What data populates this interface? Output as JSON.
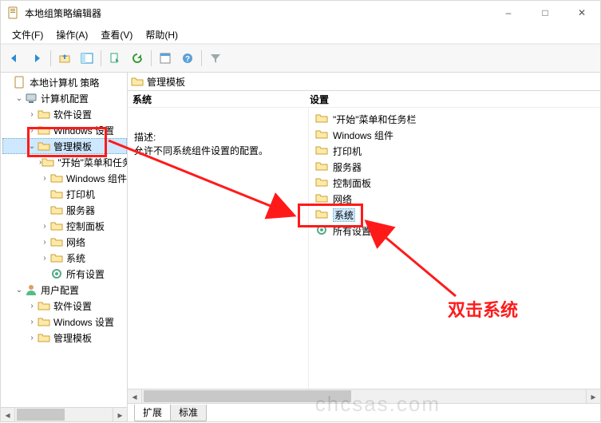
{
  "window": {
    "title": "本地组策略编辑器",
    "buttons": {
      "min": "–",
      "max": "□",
      "close": "✕"
    }
  },
  "menubar": {
    "file": "文件(F)",
    "action": "操作(A)",
    "view": "查看(V)",
    "help": "帮助(H)"
  },
  "toolbar_icons": [
    "back",
    "forward",
    "up",
    "show-hide-tree",
    "export",
    "refresh",
    "properties",
    "help",
    "filter"
  ],
  "tree": {
    "root": "本地计算机 策略",
    "computer_cfg": "计算机配置",
    "software_settings": "软件设置",
    "windows_settings": "Windows 设置",
    "admin_templates": "管理模板",
    "start_taskbar": "\"开始\"菜单和任务栏",
    "windows_components": "Windows 组件",
    "printers": "打印机",
    "servers": "服务器",
    "control_panel": "控制面板",
    "network": "网络",
    "system": "系统",
    "all_settings": "所有设置",
    "user_cfg": "用户配置",
    "u_software_settings": "软件设置",
    "u_windows_settings": "Windows 设置",
    "u_admin_templates": "管理模板"
  },
  "content": {
    "header": "管理模板",
    "col_left": "系统",
    "col_right": "设置",
    "desc_label": "描述:",
    "desc_text": "允许不同系统组件设置的配置。",
    "items": [
      {
        "label": "\"开始\"菜单和任务栏",
        "icon": "folder"
      },
      {
        "label": "Windows 组件",
        "icon": "folder"
      },
      {
        "label": "打印机",
        "icon": "folder"
      },
      {
        "label": "服务器",
        "icon": "folder"
      },
      {
        "label": "控制面板",
        "icon": "folder"
      },
      {
        "label": "网络",
        "icon": "folder"
      },
      {
        "label": "系统",
        "icon": "folder",
        "selected": true
      },
      {
        "label": "所有设置",
        "icon": "settings"
      }
    ],
    "tabs": {
      "extended": "扩展",
      "standard": "标准"
    }
  },
  "annotations": {
    "callout": "双击系统"
  },
  "watermark": "chcsas.com"
}
